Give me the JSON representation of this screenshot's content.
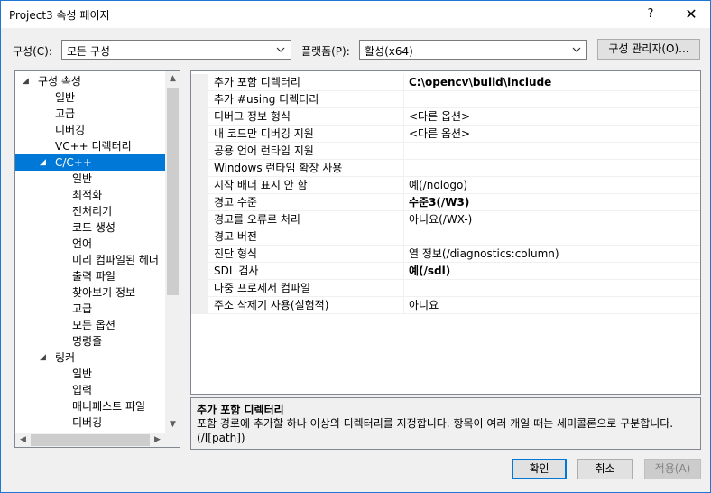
{
  "window": {
    "title": "Project3 속성 페이지",
    "help_glyph": "?",
    "close_glyph": "✕"
  },
  "config": {
    "config_label": "구성(C):",
    "config_value": "모든 구성",
    "platform_label": "플랫폼(P):",
    "platform_value": "활성(x64)",
    "manager_button": "구성 관리자(O)..."
  },
  "tree": {
    "items": [
      {
        "label": "구성 속성",
        "level": 0,
        "twisty": "◢",
        "selected": false
      },
      {
        "label": "일반",
        "level": 1,
        "twisty": "",
        "selected": false
      },
      {
        "label": "고급",
        "level": 1,
        "twisty": "",
        "selected": false
      },
      {
        "label": "디버깅",
        "level": 1,
        "twisty": "",
        "selected": false
      },
      {
        "label": "VC++ 디렉터리",
        "level": 1,
        "twisty": "",
        "selected": false
      },
      {
        "label": "C/C++",
        "level": 1,
        "twisty": "◢",
        "selected": true
      },
      {
        "label": "일반",
        "level": 2,
        "twisty": "",
        "selected": false
      },
      {
        "label": "최적화",
        "level": 2,
        "twisty": "",
        "selected": false
      },
      {
        "label": "전처리기",
        "level": 2,
        "twisty": "",
        "selected": false
      },
      {
        "label": "코드 생성",
        "level": 2,
        "twisty": "",
        "selected": false
      },
      {
        "label": "언어",
        "level": 2,
        "twisty": "",
        "selected": false
      },
      {
        "label": "미리 컴파일된 헤더",
        "level": 2,
        "twisty": "",
        "selected": false
      },
      {
        "label": "출력 파일",
        "level": 2,
        "twisty": "",
        "selected": false
      },
      {
        "label": "찾아보기 정보",
        "level": 2,
        "twisty": "",
        "selected": false
      },
      {
        "label": "고급",
        "level": 2,
        "twisty": "",
        "selected": false
      },
      {
        "label": "모든 옵션",
        "level": 2,
        "twisty": "",
        "selected": false
      },
      {
        "label": "명령줄",
        "level": 2,
        "twisty": "",
        "selected": false
      },
      {
        "label": "링커",
        "level": 1,
        "twisty": "◢",
        "selected": false
      },
      {
        "label": "일반",
        "level": 2,
        "twisty": "",
        "selected": false
      },
      {
        "label": "입력",
        "level": 2,
        "twisty": "",
        "selected": false
      },
      {
        "label": "매니페스트 파일",
        "level": 2,
        "twisty": "",
        "selected": false
      },
      {
        "label": "디버깅",
        "level": 2,
        "twisty": "",
        "selected": false
      }
    ],
    "scroll_up": "▲",
    "scroll_down": "▼",
    "scroll_left": "◀",
    "scroll_right": "▶"
  },
  "properties": [
    {
      "name": "추가 포함 디렉터리",
      "value": "C:\\opencv\\build\\include",
      "bold": true
    },
    {
      "name": "추가 #using 디렉터리",
      "value": "",
      "bold": false
    },
    {
      "name": "디버그 정보 형식",
      "value": "<다른 옵션>",
      "bold": false
    },
    {
      "name": "내 코드만 디버깅 지원",
      "value": "<다른 옵션>",
      "bold": false
    },
    {
      "name": "공용 언어 런타임 지원",
      "value": "",
      "bold": false
    },
    {
      "name": "Windows 런타임 확장 사용",
      "value": "",
      "bold": false
    },
    {
      "name": "시작 배너 표시 안 함",
      "value": "예(/nologo)",
      "bold": false
    },
    {
      "name": "경고 수준",
      "value": "수준3(/W3)",
      "bold": true
    },
    {
      "name": "경고를 오류로 처리",
      "value": "아니요(/WX-)",
      "bold": false
    },
    {
      "name": "경고 버전",
      "value": "",
      "bold": false
    },
    {
      "name": "진단 형식",
      "value": "열 정보(/diagnostics:column)",
      "bold": false
    },
    {
      "name": "SDL 검사",
      "value": "예(/sdl)",
      "bold": true
    },
    {
      "name": "다중 프로세서 컴파일",
      "value": "",
      "bold": false
    },
    {
      "name": "주소 삭제기 사용(실험적)",
      "value": "아니요",
      "bold": false
    }
  ],
  "description": {
    "title": "추가 포함 디렉터리",
    "text": "포함 경로에 추가할 하나 이상의 디렉터리를 지정합니다. 항목이 여러 개일 때는 세미콜론으로 구분합니다.     (/I[path])"
  },
  "buttons": {
    "ok": "확인",
    "cancel": "취소",
    "apply": "적용(A)"
  }
}
